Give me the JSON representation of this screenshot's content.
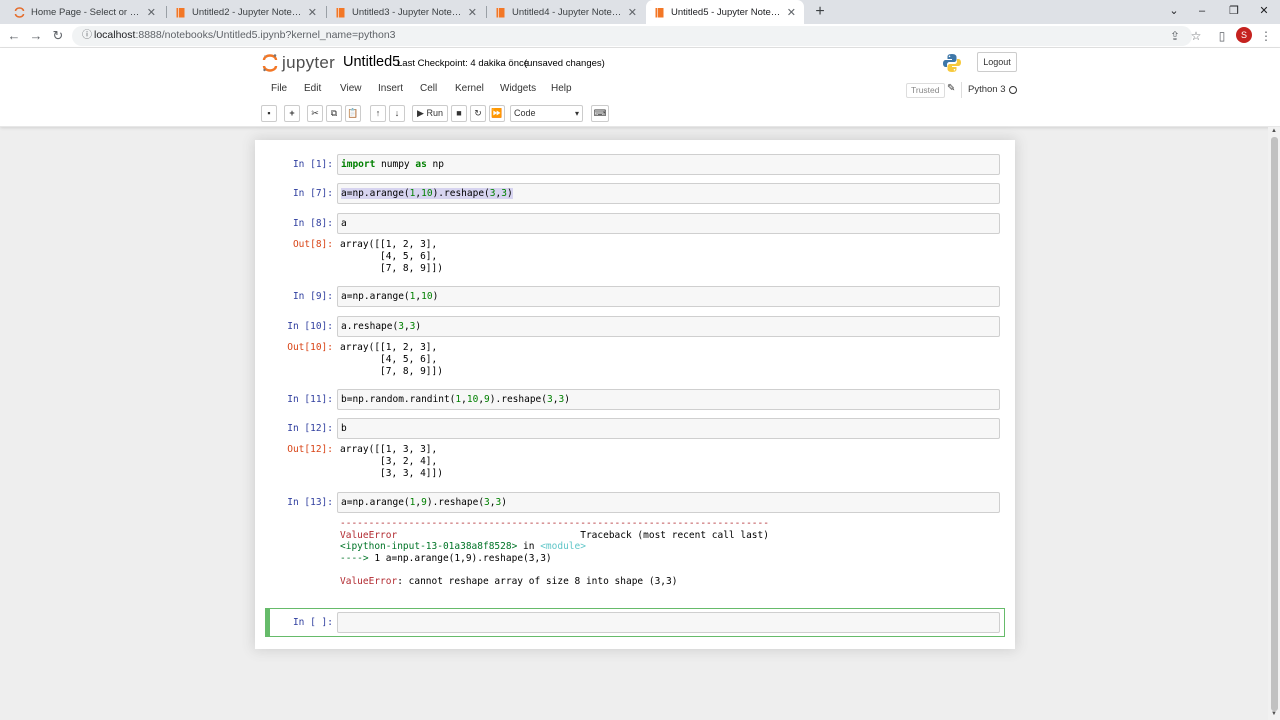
{
  "browser": {
    "tabs": [
      {
        "title": "Home Page - Select or create a n",
        "active": false
      },
      {
        "title": "Untitled2 - Jupyter Notebook",
        "active": false
      },
      {
        "title": "Untitled3 - Jupyter Notebook",
        "active": false
      },
      {
        "title": "Untitled4 - Jupyter Notebook",
        "active": false
      },
      {
        "title": "Untitled5 - Jupyter Notebook",
        "active": true
      }
    ],
    "url_host": "localhost",
    "url_rest": ":8888/notebooks/Untitled5.ipynb?kernel_name=python3",
    "profile_initial": "S"
  },
  "jupyter": {
    "logo_text": "jupyter",
    "notebook_name": "Untitled5",
    "checkpoint": "Last Checkpoint: 4 dakika önce",
    "unsaved": "(unsaved changes)",
    "logout": "Logout",
    "menus": [
      "File",
      "Edit",
      "View",
      "Insert",
      "Cell",
      "Kernel",
      "Widgets",
      "Help"
    ],
    "trusted": "Trusted",
    "kernel_name": "Python 3",
    "toolbar": {
      "run_label": "Run",
      "cell_type": "Code"
    }
  },
  "cells": [
    {
      "prompt": "In [1]:",
      "code": "import numpy as np"
    },
    {
      "prompt": "In [7]:",
      "code": "a=np.arange(1,10).reshape(3,3)"
    },
    {
      "prompt": "In [8]:",
      "code": "a",
      "out_prompt": "Out[8]:",
      "output": "array([[1, 2, 3],\n       [4, 5, 6],\n       [7, 8, 9]])"
    },
    {
      "prompt": "In [9]:",
      "code": "a=np.arange(1,10)"
    },
    {
      "prompt": "In [10]:",
      "code": "a.reshape(3,3)",
      "out_prompt": "Out[10]:",
      "output": "array([[1, 2, 3],\n       [4, 5, 6],\n       [7, 8, 9]])"
    },
    {
      "prompt": "In [11]:",
      "code": "b=np.random.randint(1,10,9).reshape(3,3)"
    },
    {
      "prompt": "In [12]:",
      "code": "b",
      "out_prompt": "Out[12]:",
      "output": "array([[1, 3, 3],\n       [3, 2, 4],\n       [3, 3, 4]])"
    },
    {
      "prompt": "In [13]:",
      "code": "a=np.arange(1,9).reshape(3,3)"
    },
    {
      "prompt": "In [ ]:",
      "code": ""
    }
  ],
  "error": {
    "dashes": "---------------------------------------------------------------------------",
    "name": "ValueError",
    "traceback_label": "Traceback (most recent call last)",
    "input_ref": "<ipython-input-13-01a38a8f8528>",
    "in_word": " in ",
    "module": "<module>",
    "arrow_line": "----> 1 a=np.arange(1,9).reshape(3,3)",
    "final_name": "ValueError",
    "final_msg": ": cannot reshape array of size 8 into shape (3,3)"
  }
}
